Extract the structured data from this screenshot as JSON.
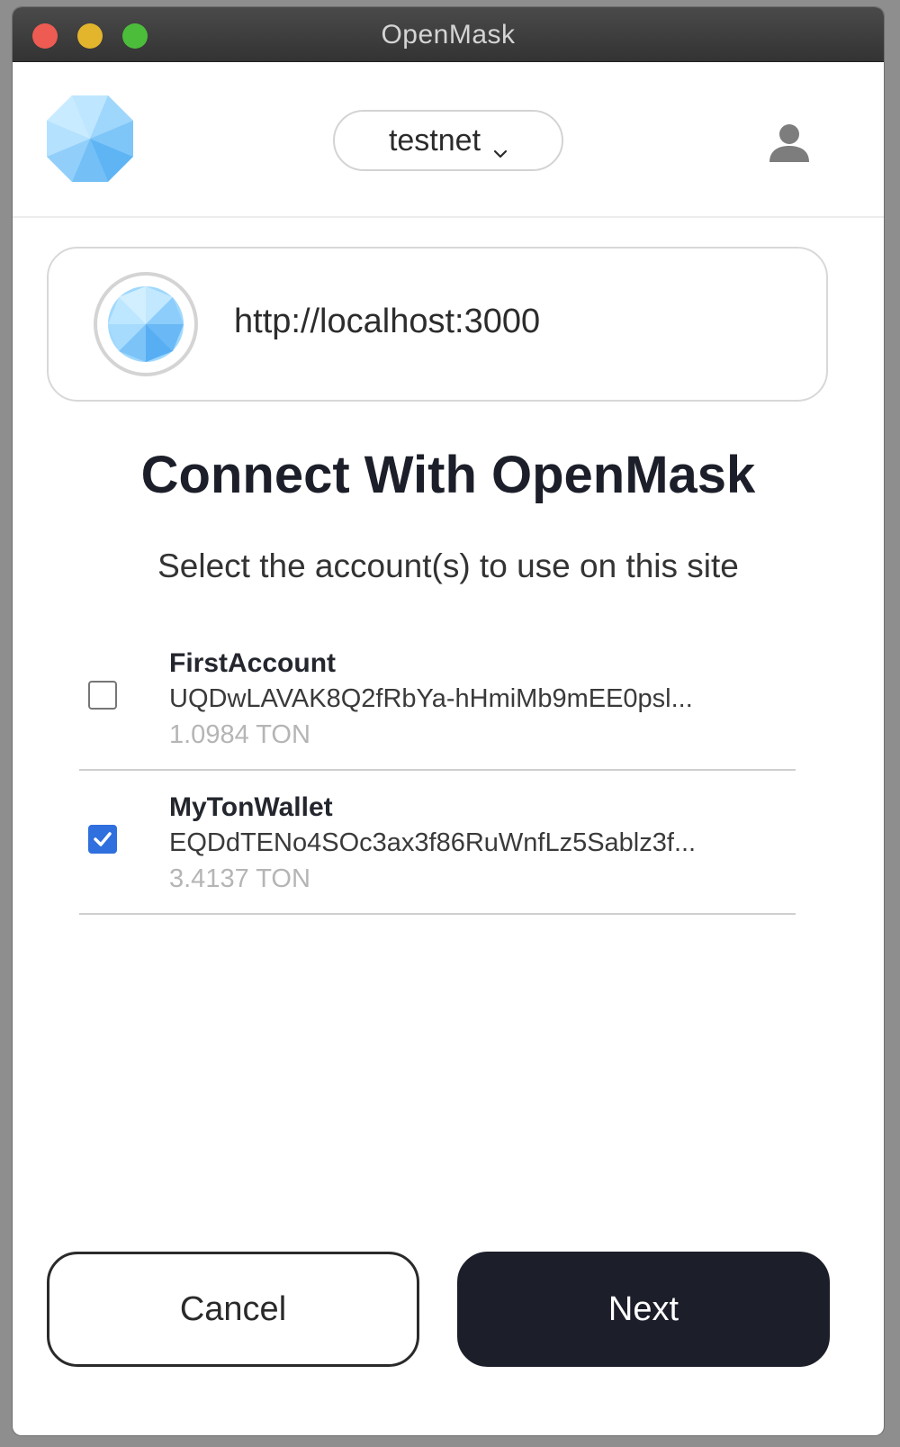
{
  "window": {
    "title": "OpenMask"
  },
  "header": {
    "network": "testnet",
    "logo_icon": "openmask-logo-icon",
    "chevron_icon": "chevron-down-icon",
    "account_icon": "user-icon"
  },
  "origin": {
    "url": "http://localhost:3000",
    "favicon_icon": "site-favicon-icon"
  },
  "main": {
    "heading": "Connect With OpenMask",
    "subheading": "Select the account(s) to use on this site"
  },
  "accounts": [
    {
      "name": "FirstAccount",
      "address": "UQDwLAVAK8Q2fRbYa-hHmiMb9mEE0psl...",
      "balance": "1.0984 TON",
      "checked": false
    },
    {
      "name": "MyTonWallet",
      "address": "EQDdTENo4SOc3ax3f86RuWnfLz5Sablz3f...",
      "balance": "3.4137 TON",
      "checked": true
    }
  ],
  "actions": {
    "cancel_label": "Cancel",
    "next_label": "Next"
  },
  "colors": {
    "primary_dark": "#1c1f29",
    "checkbox_accent": "#2f6fde",
    "logo_blue": "#8fd0fb"
  }
}
